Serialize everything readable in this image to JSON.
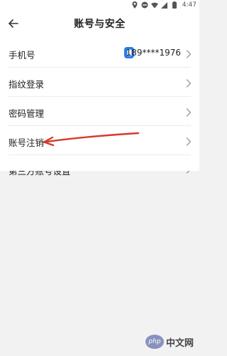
{
  "status_bar": {
    "time": "4:47",
    "icons": [
      "location-icon",
      "do-not-disturb-icon",
      "wifi-icon",
      "cellular-signal-icon",
      "battery-icon"
    ]
  },
  "header": {
    "title": "账号与安全",
    "back_icon": "back-arrow-icon"
  },
  "settings": {
    "items": [
      {
        "label": "手机号",
        "value": "189****1976",
        "icon": "phone-badge-icon"
      },
      {
        "label": "指纹登录"
      },
      {
        "label": "密码管理"
      },
      {
        "label": "账号注销"
      },
      {
        "label": "第三方账号设置"
      }
    ]
  },
  "annotation": {
    "type": "red-arrow",
    "points_to": "账号注销",
    "color": "#d63a2a"
  },
  "watermark": {
    "logo_text": "php",
    "text": "中文网"
  },
  "colors": {
    "accent": "#2b7de9",
    "background": "#f2f2f2",
    "surface": "#ffffff"
  }
}
